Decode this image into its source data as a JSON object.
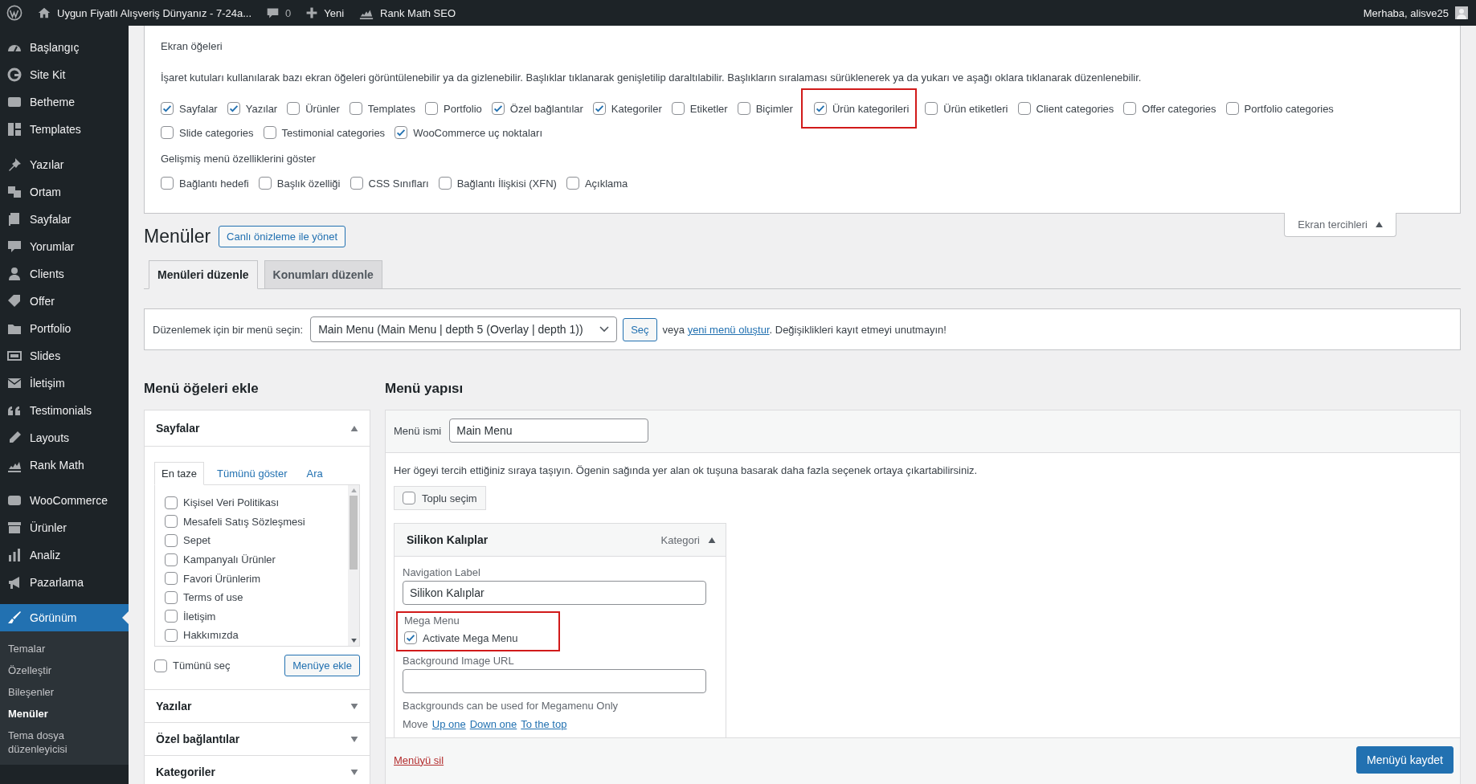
{
  "admin_bar": {
    "site_title": "Uygun Fiyatlı Alışveriş Dünyanız - 7-24a...",
    "comments_count": "0",
    "new_label": "Yeni",
    "seo_label": "Rank Math SEO",
    "greeting": "Merhaba, alisve25"
  },
  "sidebar": {
    "sections": [
      {
        "items": [
          {
            "label": "Başlangıç",
            "selected": false
          },
          {
            "label": "Site Kit",
            "selected": false
          },
          {
            "label": "Betheme",
            "selected": false
          },
          {
            "label": "Templates",
            "selected": false
          }
        ]
      },
      {
        "items": [
          {
            "label": "Yazılar",
            "selected": false
          },
          {
            "label": "Ortam",
            "selected": false
          },
          {
            "label": "Sayfalar",
            "selected": false
          },
          {
            "label": "Yorumlar",
            "selected": false
          },
          {
            "label": "Clients",
            "selected": false
          },
          {
            "label": "Offer",
            "selected": false
          },
          {
            "label": "Portfolio",
            "selected": false
          },
          {
            "label": "Slides",
            "selected": false
          },
          {
            "label": "İletişim",
            "selected": false
          },
          {
            "label": "Testimonials",
            "selected": false
          },
          {
            "label": "Layouts",
            "selected": false
          },
          {
            "label": "Rank Math",
            "selected": false
          }
        ]
      },
      {
        "items": [
          {
            "label": "WooCommerce",
            "selected": false
          },
          {
            "label": "Ürünler",
            "selected": false
          },
          {
            "label": "Analiz",
            "selected": false
          },
          {
            "label": "Pazarlama",
            "selected": false
          }
        ]
      },
      {
        "items": [
          {
            "label": "Görünüm",
            "selected": true,
            "children": [
              {
                "label": "Temalar",
                "selected": false
              },
              {
                "label": "Özelleştir",
                "selected": false
              },
              {
                "label": "Bileşenler",
                "selected": false
              },
              {
                "label": "Menüler",
                "selected": true
              },
              {
                "label": "Tema dosya düzenleyicisi",
                "selected": false
              }
            ]
          }
        ]
      }
    ]
  },
  "screen_options": {
    "title": "Ekran öğeleri",
    "description": "İşaret kutuları kullanılarak bazı ekran öğeleri görüntülenebilir ya da gizlenebilir. Başlıklar tıklanarak genişletilip daraltılabilir. Başlıkların sıralaması sürüklenerek ya da yukarı ve aşağı oklara tıklanarak düzenlenebilir.",
    "boxes": [
      {
        "label": "Sayfalar",
        "checked": true,
        "highlighted": false
      },
      {
        "label": "Yazılar",
        "checked": true,
        "highlighted": false
      },
      {
        "label": "Ürünler",
        "checked": false,
        "highlighted": false
      },
      {
        "label": "Templates",
        "checked": false,
        "highlighted": false
      },
      {
        "label": "Portfolio",
        "checked": false,
        "highlighted": false
      },
      {
        "label": "Özel bağlantılar",
        "checked": true,
        "highlighted": false
      },
      {
        "label": "Kategoriler",
        "checked": true,
        "highlighted": false
      },
      {
        "label": "Etiketler",
        "checked": false,
        "highlighted": false
      },
      {
        "label": "Biçimler",
        "checked": false,
        "highlighted": false
      },
      {
        "label": "Ürün kategorileri",
        "checked": true,
        "highlighted": true
      },
      {
        "label": "Ürün etiketleri",
        "checked": false,
        "highlighted": false
      },
      {
        "label": "Client categories",
        "checked": false,
        "highlighted": false
      },
      {
        "label": "Offer categories",
        "checked": false,
        "highlighted": false
      },
      {
        "label": "Portfolio categories",
        "checked": false,
        "highlighted": false
      },
      {
        "label": "Slide categories",
        "checked": false,
        "highlighted": false
      },
      {
        "label": "Testimonial categories",
        "checked": false,
        "highlighted": false
      },
      {
        "label": "WooCommerce uç noktaları",
        "checked": true,
        "highlighted": false
      }
    ],
    "advanced_title": "Gelişmiş menü özelliklerini göster",
    "advanced": [
      {
        "label": "Bağlantı hedefi",
        "checked": false
      },
      {
        "label": "Başlık özelliği",
        "checked": false
      },
      {
        "label": "CSS Sınıfları",
        "checked": false
      },
      {
        "label": "Bağlantı İlişkisi (XFN)",
        "checked": false
      },
      {
        "label": "Açıklama",
        "checked": false
      }
    ],
    "toggle": {
      "label": "Ekran tercihleri",
      "expanded": true
    }
  },
  "page": {
    "title": "Menüler",
    "action_button": "Canlı önizleme ile yönet",
    "tabs": [
      {
        "label": "Menüleri düzenle",
        "selected": true
      },
      {
        "label": "Konumları düzenle",
        "selected": false
      }
    ]
  },
  "menu_select": {
    "label": "Düzenlemek için bir menü seçin:",
    "value": "Main Menu (Main Menu | depth 5 (Overlay | depth 1))",
    "button": "Seç",
    "note_before": "veya",
    "link": "yeni menü oluştur",
    "note_after": ". Değişiklikleri kayıt etmeyi unutmayın!"
  },
  "add_items": {
    "title": "Menü öğeleri ekle",
    "sections": [
      {
        "title": "Sayfalar",
        "expanded": true,
        "tabs": [
          {
            "label": "En taze",
            "selected": true
          },
          {
            "label": "Tümünü göster",
            "selected": false
          },
          {
            "label": "Ara",
            "selected": false
          }
        ],
        "items": [
          {
            "label": "Kişisel Veri Politikası",
            "checked": false
          },
          {
            "label": "Mesafeli Satış Sözleşmesi",
            "checked": false
          },
          {
            "label": "Sepet",
            "checked": false
          },
          {
            "label": "Kampanyalı Ürünler",
            "checked": false
          },
          {
            "label": "Favori Ürünlerim",
            "checked": false
          },
          {
            "label": "Terms of use",
            "checked": false
          },
          {
            "label": "İletişim",
            "checked": false
          },
          {
            "label": "Hakkımızda",
            "checked": false
          }
        ],
        "select_all": {
          "label": "Tümünü seç",
          "checked": false
        },
        "add_button": "Menüye ekle"
      },
      {
        "title": "Yazılar",
        "expanded": false
      },
      {
        "title": "Özel bağlantılar",
        "expanded": false
      },
      {
        "title": "Kategoriler",
        "expanded": false
      }
    ]
  },
  "structure": {
    "title": "Menü yapısı",
    "name_label": "Menü ismi",
    "name_value": "Main Menu",
    "instructions": "Her ögeyi tercih ettiğiniz sıraya taşıyın. Ögenin sağında yer alan ok tuşuna basarak daha fazla seçenek ortaya çıkartabilirsiniz.",
    "bulk_select": {
      "label": "Toplu seçim",
      "checked": false
    },
    "items": [
      {
        "title": "Silikon Kalıplar",
        "type": "Kategori",
        "expanded": true,
        "nav_label_title": "Navigation Label",
        "nav_label_value": "Silikon Kalıplar",
        "mega_title": "Mega Menu",
        "mega_checkbox": {
          "label": "Activate Mega Menu",
          "checked": true
        },
        "mega_highlighted": true,
        "bg_label": "Background Image URL",
        "bg_hint": "Backgrounds can be used for Megamenu Only",
        "move_label": "Move",
        "move_links": [
          "Up one",
          "Down one",
          "To the top"
        ]
      }
    ],
    "delete_link": "Menüyü sil",
    "save_button": "Menüyü kaydet"
  }
}
